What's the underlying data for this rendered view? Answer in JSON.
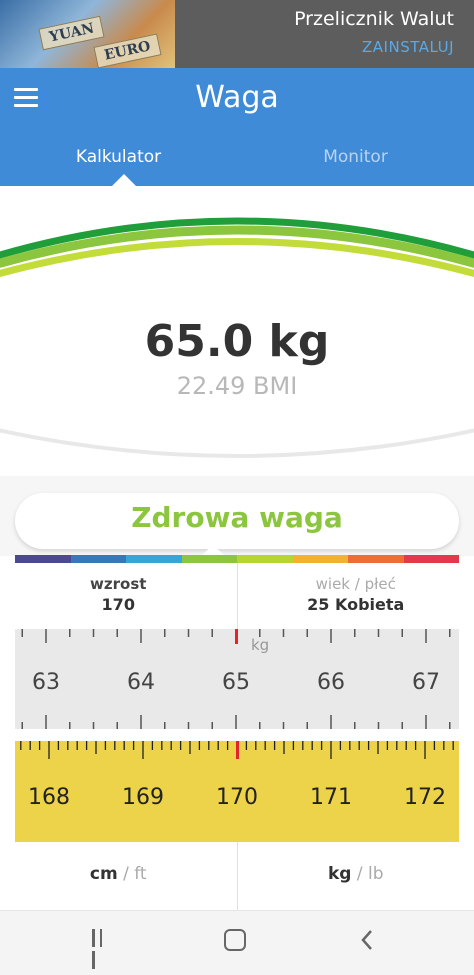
{
  "ad": {
    "title": "Przelicznik Walut",
    "cta": "ZAINSTALUJ",
    "note_labels": [
      "YUAN",
      "EURO"
    ]
  },
  "appbar": {
    "title": "Waga",
    "menu_icon": "hamburger-menu-icon"
  },
  "tabs": [
    {
      "label": "Kalkulator",
      "active": true
    },
    {
      "label": "Monitor",
      "active": false
    }
  ],
  "result": {
    "weight": "65.0 kg",
    "bmi": "22.49 BMI",
    "status": "Zdrowa waga"
  },
  "info": {
    "height_label": "wzrost",
    "height_value": "170",
    "age_label": "wiek",
    "sex_label": "płeć",
    "age_sex_value": "25 Kobieta"
  },
  "weight_ruler": {
    "unit": "kg",
    "ticks": [
      "63",
      "64",
      "65",
      "66",
      "67"
    ],
    "selected": 65
  },
  "height_tape": {
    "ticks": [
      "168",
      "169",
      "170",
      "171",
      "172"
    ],
    "selected": 170
  },
  "units": {
    "height_primary": "cm",
    "height_alt": "ft",
    "weight_primary": "kg",
    "weight_alt": "lb"
  },
  "colors": {
    "primary": "#3f8bd8",
    "healthy": "#8cc63f",
    "tape": "#ecd34a",
    "indicator": "#e3242b",
    "bmi_bar": [
      "#4b4a8f",
      "#3779b8",
      "#35a6d6",
      "#8cc63f",
      "#b7d532",
      "#f2b12e",
      "#ef6c35",
      "#e23a4a"
    ]
  },
  "navbar": {
    "recent_icon": "recent-apps-icon",
    "home_icon": "home-icon",
    "back_icon": "back-icon"
  }
}
